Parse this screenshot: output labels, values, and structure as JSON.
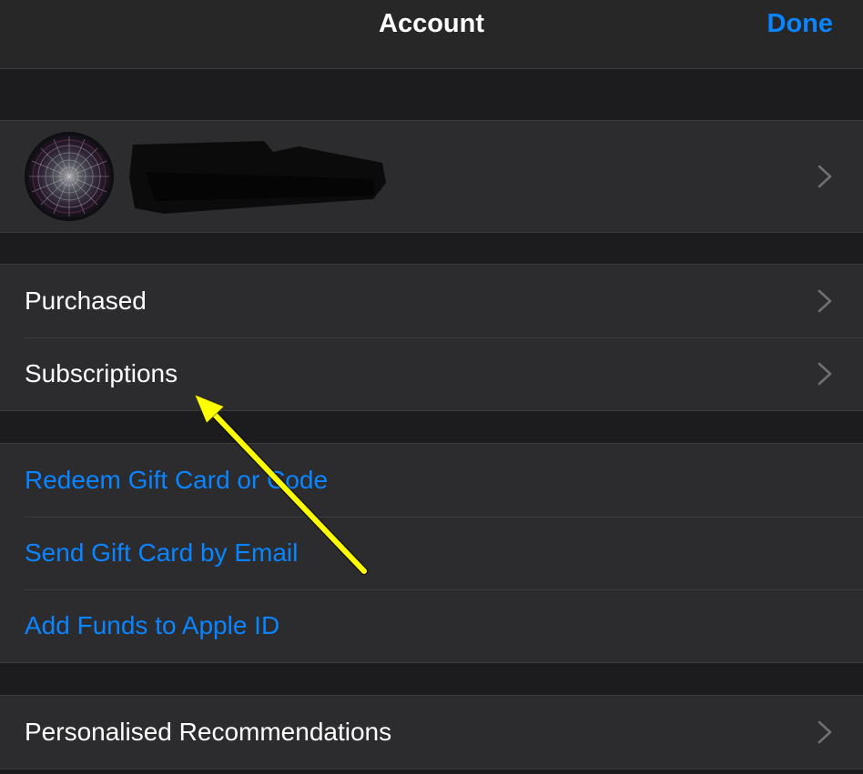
{
  "nav": {
    "title": "Account",
    "done_label": "Done"
  },
  "colors": {
    "accent": "#0a84ff",
    "annotation_arrow": "#ffff00",
    "background": "#1c1c1e",
    "cell": "#2c2c2e"
  },
  "profile": {
    "avatar_icon": "avatar-icon",
    "name_redacted": true
  },
  "purchases_group": [
    {
      "label": "Purchased"
    },
    {
      "label": "Subscriptions"
    }
  ],
  "gift_group": [
    {
      "label": "Redeem Gift Card or Code"
    },
    {
      "label": "Send Gift Card by Email"
    },
    {
      "label": "Add Funds to Apple ID"
    }
  ],
  "recommendations_group": [
    {
      "label": "Personalised Recommendations"
    }
  ]
}
